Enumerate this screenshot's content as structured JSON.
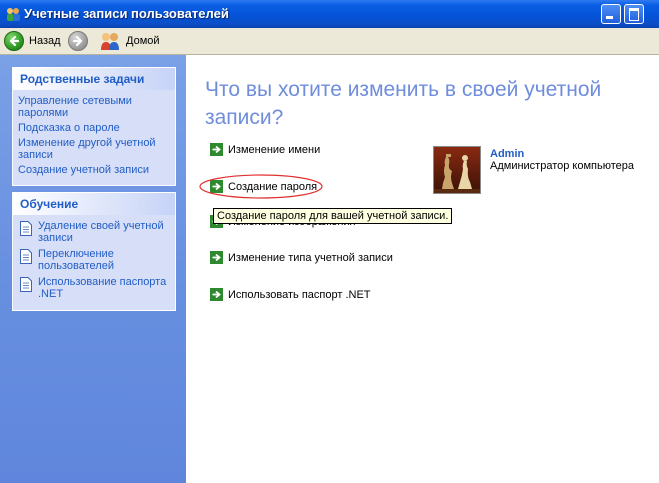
{
  "window": {
    "title": "Учетные записи пользователей",
    "icon": "users-icon",
    "buttons": [
      "minimize",
      "maximize"
    ]
  },
  "toolbar": {
    "back_label": "Назад",
    "forward_icon": "forward-arrow-icon",
    "home_label": "Домой"
  },
  "sidebar": {
    "related_tasks": {
      "title": "Родственные задачи",
      "items": [
        {
          "label": "Управление сетевыми паролями"
        },
        {
          "label": "Подсказка о пароле"
        },
        {
          "label": "Изменение другой учетной записи"
        },
        {
          "label": "Создание учетной записи"
        }
      ]
    },
    "learn": {
      "title": "Обучение",
      "items": [
        {
          "label": "Удаление своей учетной записи",
          "icon": "document-icon"
        },
        {
          "label": "Переключение пользователей",
          "icon": "document-icon"
        },
        {
          "label": "Использование паспорта .NET",
          "icon": "document-icon"
        }
      ]
    }
  },
  "main": {
    "title": "Что вы хотите изменить в своей учетной записи?",
    "actions": [
      {
        "label": "Изменение имени"
      },
      {
        "label": "Создание пароля"
      },
      {
        "label": "Изменение изображения"
      },
      {
        "label": "Изменение типа учетной записи"
      },
      {
        "label": "Использовать паспорт .NET"
      }
    ],
    "tooltip": "Создание пароля для вашей учетной записи.",
    "user": {
      "name": "Admin",
      "role": "Администратор компьютера",
      "picture": "chess-pieces-avatar"
    }
  },
  "colors": {
    "title_bar": "#0553d8",
    "sidebar_bg": "#6890e0",
    "link": "#215dc6",
    "heading": "#6f8ddc",
    "highlight": "#e03030"
  }
}
